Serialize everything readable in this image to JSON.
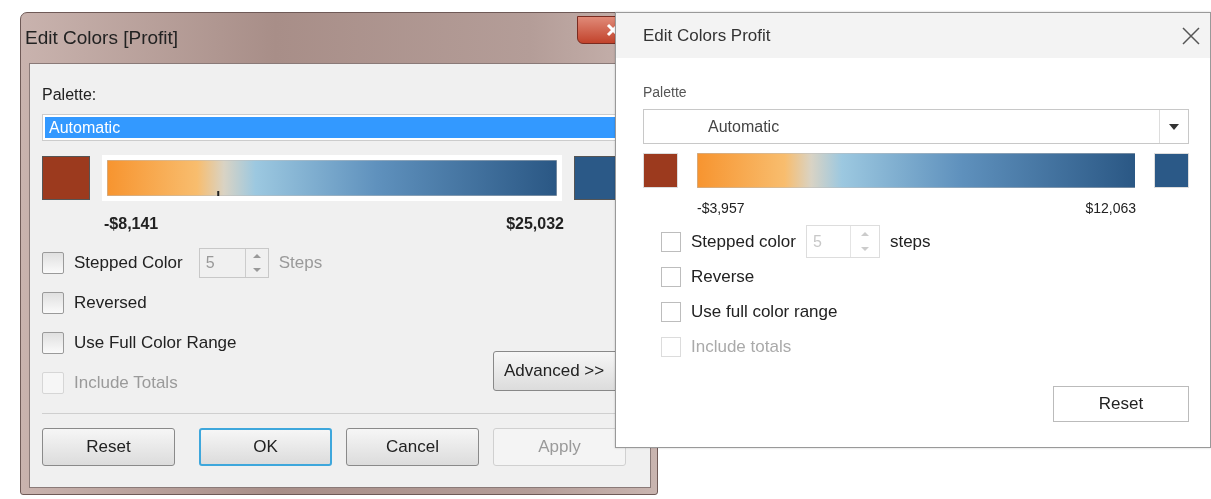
{
  "classic_dialog": {
    "title": "Edit Colors [Profit]",
    "palette_label": "Palette:",
    "palette_value": "Automatic",
    "range_min": "-$8,141",
    "range_max": "$25,032",
    "options": [
      {
        "kind": "stepped",
        "label": "Stepped Color",
        "checked": false,
        "disabled": false,
        "steps": "5",
        "steps_label": "Steps"
      },
      {
        "kind": "plain",
        "label": "Reversed",
        "checked": false,
        "disabled": false
      },
      {
        "kind": "plain",
        "label": "Use Full Color Range",
        "checked": false,
        "disabled": false
      },
      {
        "kind": "plain",
        "label": "Include Totals",
        "checked": false,
        "disabled": true
      }
    ],
    "advanced_button": "Advanced >>",
    "buttons": [
      {
        "label": "Reset",
        "kind": "normal"
      },
      {
        "label": "OK",
        "kind": "default"
      },
      {
        "label": "Cancel",
        "kind": "normal"
      },
      {
        "label": "Apply",
        "kind": "disabled"
      }
    ]
  },
  "modern_dialog": {
    "title": "Edit Colors Profit",
    "palette_label": "Palette",
    "palette_value": "Automatic",
    "range_min": "-$3,957",
    "range_max": "$12,063",
    "options": [
      {
        "kind": "stepped",
        "label": "Stepped color",
        "checked": false,
        "disabled": false,
        "steps": "5",
        "steps_label": "steps"
      },
      {
        "kind": "plain",
        "label": "Reverse",
        "checked": false,
        "disabled": false
      },
      {
        "kind": "plain",
        "label": "Use full color range",
        "checked": false,
        "disabled": false
      },
      {
        "kind": "plain",
        "label": "Include totals",
        "checked": false,
        "disabled": true
      }
    ],
    "reset_button": "Reset"
  }
}
